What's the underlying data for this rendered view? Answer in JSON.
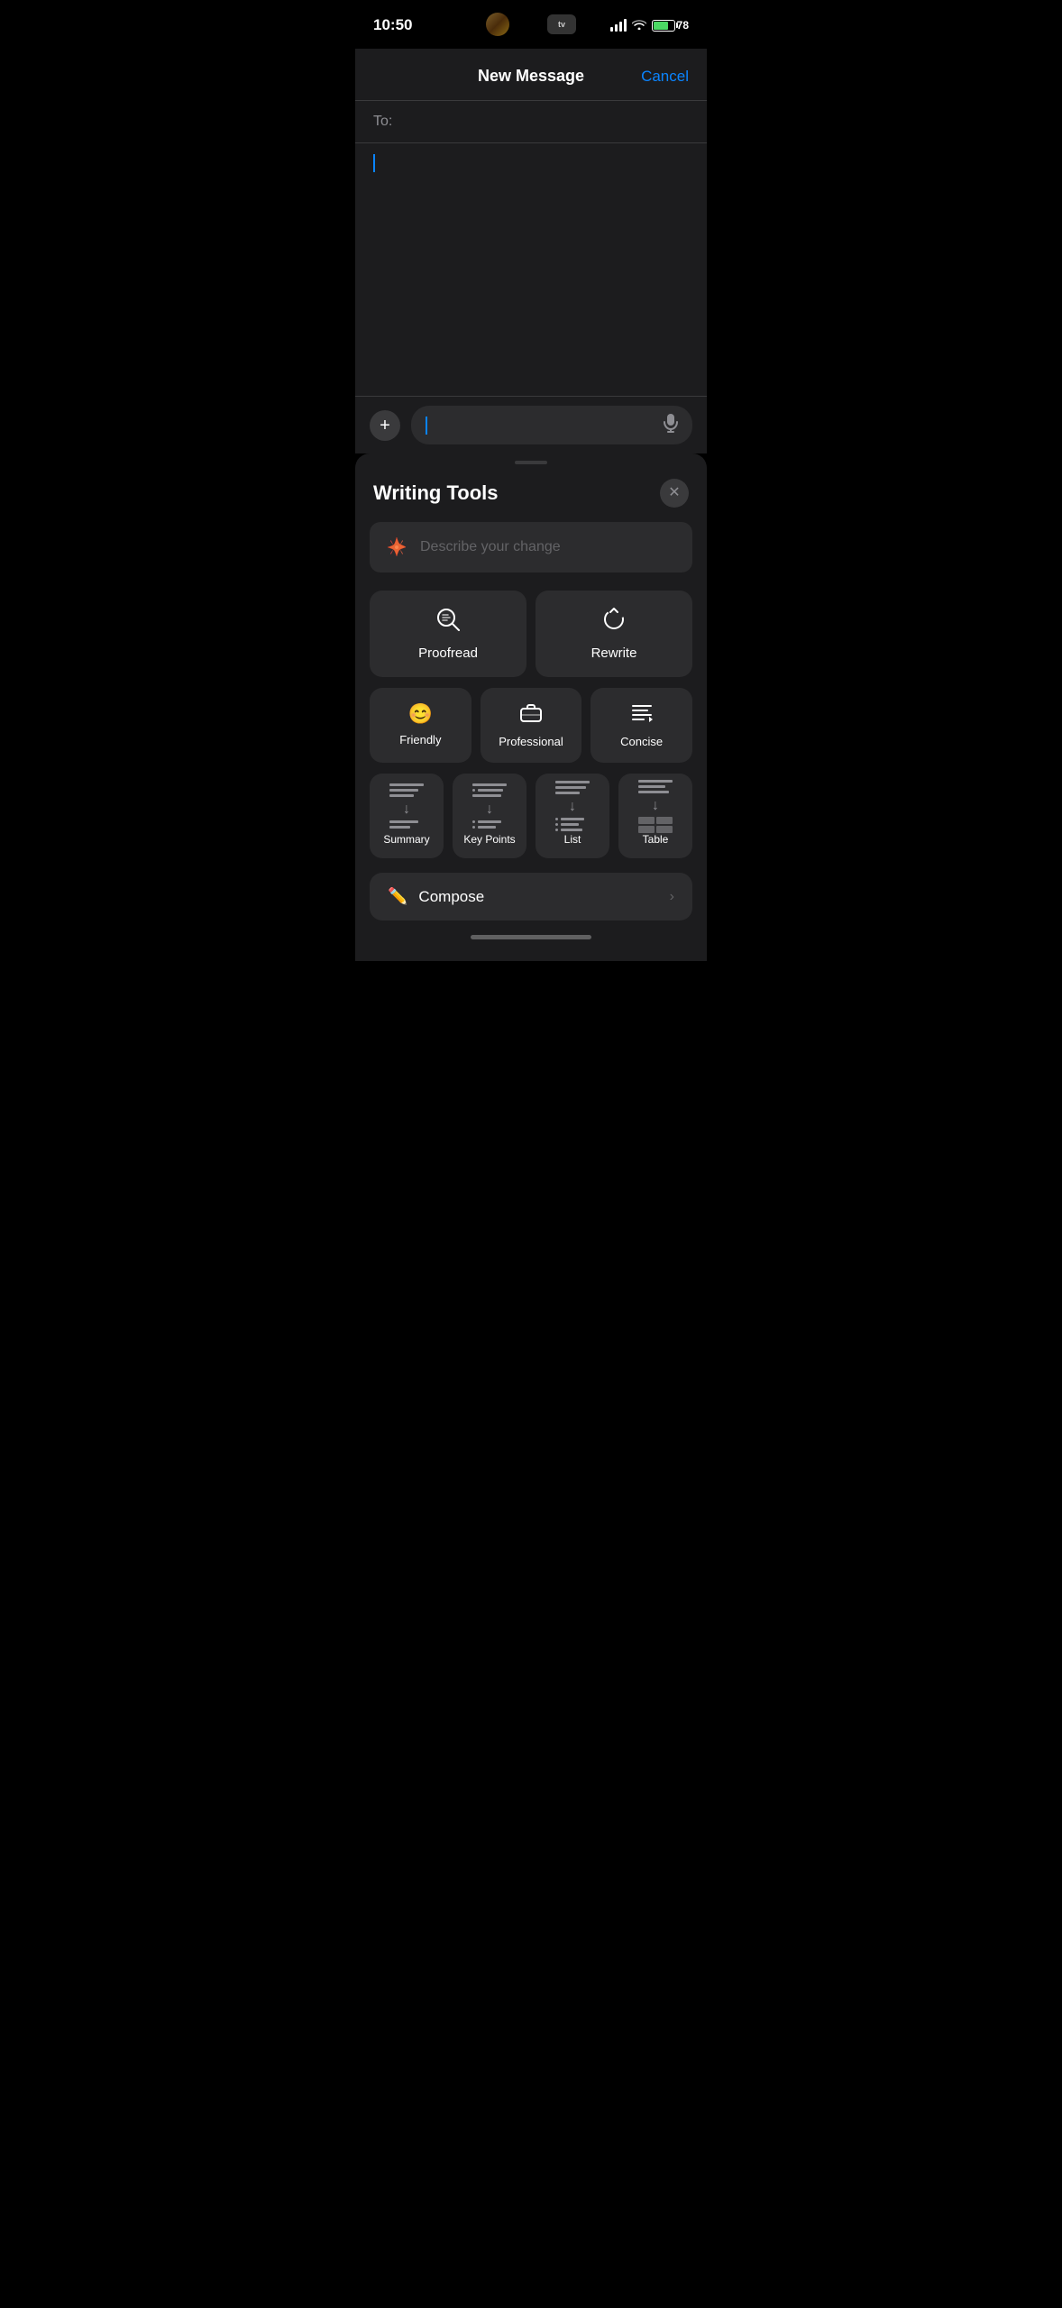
{
  "statusBar": {
    "time": "10:50",
    "batteryPercent": "78",
    "batteryIcon": "battery"
  },
  "header": {
    "title": "New Message",
    "cancelLabel": "Cancel"
  },
  "toField": {
    "label": "To:"
  },
  "inputField": {
    "placeholder": ""
  },
  "writingTools": {
    "title": "Writing Tools",
    "closeIcon": "×",
    "describePrompt": "Describe your change",
    "mainTools": [
      {
        "id": "proofread",
        "label": "Proofread",
        "icon": "proofread"
      },
      {
        "id": "rewrite",
        "label": "Rewrite",
        "icon": "rewrite"
      }
    ],
    "toneTools": [
      {
        "id": "friendly",
        "label": "Friendly",
        "icon": "😊"
      },
      {
        "id": "professional",
        "label": "Professional",
        "icon": "briefcase"
      },
      {
        "id": "concise",
        "label": "Concise",
        "icon": "concise"
      }
    ],
    "formatTools": [
      {
        "id": "summary",
        "label": "Summary",
        "icon": "summary"
      },
      {
        "id": "key-points",
        "label": "Key Points",
        "icon": "keypoints"
      },
      {
        "id": "list",
        "label": "List",
        "icon": "list"
      },
      {
        "id": "table",
        "label": "Table",
        "icon": "table"
      }
    ],
    "composeLabel": "Compose",
    "composePencilIcon": "✏",
    "chevronRight": "›"
  }
}
